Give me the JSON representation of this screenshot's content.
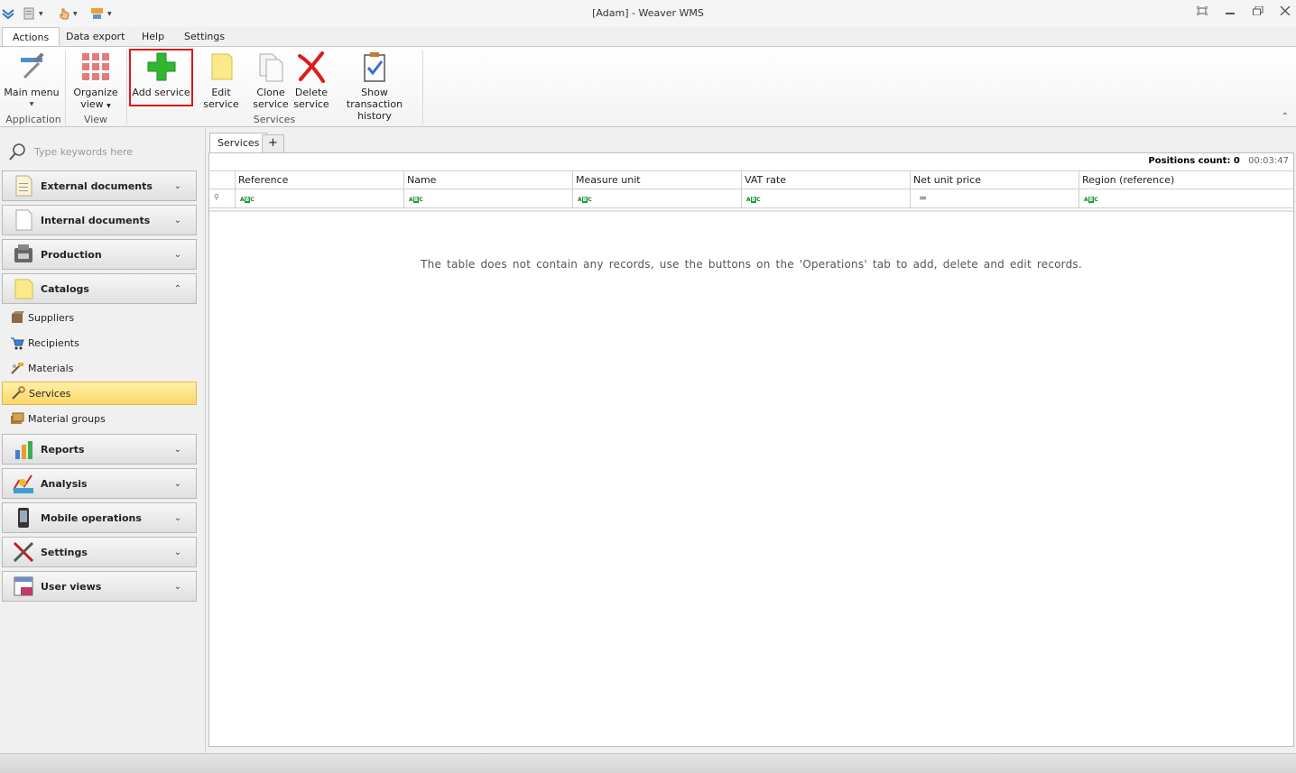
{
  "window": {
    "title": "[Adam] - Weaver WMS"
  },
  "ribbon_tabs": [
    {
      "label": "Actions",
      "active": true
    },
    {
      "label": "Data export"
    },
    {
      "label": "Help"
    },
    {
      "label": "Settings"
    }
  ],
  "ribbon": {
    "main_menu": "Main menu",
    "organize_view_1": "Organize",
    "organize_view_2": "view",
    "add_service": "Add service",
    "edit_service": "Edit service",
    "clone_service_1": "Clone",
    "clone_service_2": "service",
    "delete_service_1": "Delete",
    "delete_service_2": "service",
    "show_history_1": "Show transaction",
    "show_history_2": "history",
    "group_application": "Application",
    "group_view": "View",
    "group_services": "Services"
  },
  "sidebar": {
    "search_placeholder": "Type keywords here",
    "groups": {
      "external_documents": "External documents",
      "internal_documents": "Internal documents",
      "production": "Production",
      "catalogs": "Catalogs",
      "reports": "Reports",
      "analysis": "Analysis",
      "mobile_operations": "Mobile operations",
      "settings": "Settings",
      "user_views": "User views"
    },
    "catalog_items": {
      "suppliers": "Suppliers",
      "recipients": "Recipients",
      "materials": "Materials",
      "services": "Services",
      "material_groups": "Material groups"
    },
    "selected_item": "Services"
  },
  "document_tabs": {
    "services": "Services",
    "add": "+"
  },
  "grid": {
    "positions_label": "Positions count: 0",
    "timer": "00:03:47",
    "columns": {
      "reference": "Reference",
      "name": "Name",
      "measure_unit": "Measure unit",
      "vat_rate": "VAT rate",
      "net_unit_price": "Net unit price",
      "region": "Region (reference)"
    },
    "filter_abc": {
      "left": "A",
      "mid": "B",
      "right": "C"
    },
    "filter_eq": "=",
    "empty_message": "The table does not contain any records, use the buttons on the 'Operations' tab to add, delete and edit records."
  },
  "colors": {
    "highlight": "#e0161b",
    "selected_item_bg": "#fbd869",
    "add_icon_green": "#2eb82e",
    "delete_icon_red": "#d81e1e"
  }
}
